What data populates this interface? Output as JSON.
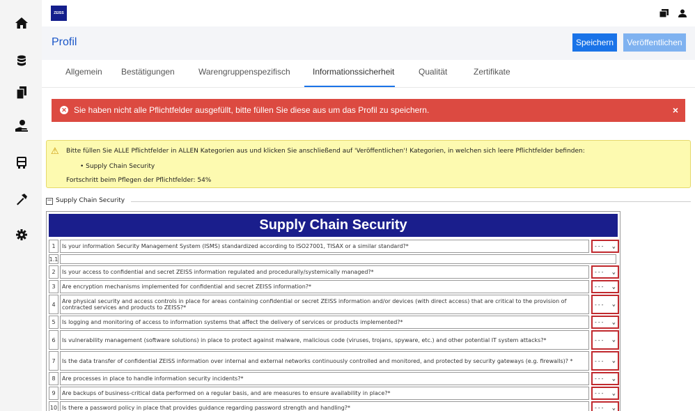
{
  "sidebar": {
    "items": [
      {
        "icon": "home-icon"
      },
      {
        "icon": "database-icon"
      },
      {
        "icon": "documents-icon"
      },
      {
        "icon": "hand-user-icon"
      },
      {
        "icon": "truck-icon"
      },
      {
        "icon": "hammer-icon"
      },
      {
        "icon": "gear-icon"
      }
    ]
  },
  "header": {
    "logo": "ZEISS",
    "title": "Profil",
    "save_label": "Speichern",
    "publish_label": "Veröffentlichen"
  },
  "tabs": [
    {
      "label": "Allgemein"
    },
    {
      "label": "Bestätigungen"
    },
    {
      "label": "Warengruppenspezifisch"
    },
    {
      "label": "Informationssicherheit"
    },
    {
      "label": "Qualität"
    },
    {
      "label": "Zertifikate"
    }
  ],
  "alert": {
    "message": "Sie haben nicht alle Pflichtfelder ausgefüllt, bitte füllen Sie diese aus um das Profil zu speichern.",
    "close": "×"
  },
  "warning": {
    "text": "Bitte füllen Sie ALLE Pflichtfelder in ALLEN Kategorien aus und klicken Sie anschließend auf 'Veröffentlichen'! Kategorien, in welchen sich leere Pflichtfelder befinden:",
    "item": "• Supply Chain Security",
    "progress": "Fortschritt beim Pflegen der Pflichtfelder: 54%"
  },
  "section": {
    "legend": "Supply Chain Security",
    "collapse": "−",
    "heading": "Supply Chain Security",
    "select_value": "---",
    "rows": [
      {
        "num": "1",
        "q": "Is your information Security Management System (ISMS) standardized according to ISO27001, TISAX or a similar standard?*"
      },
      {
        "num": "1.1",
        "q": ""
      },
      {
        "num": "2",
        "q": "Is your access to confidential and secret ZEISS information regulated and procedurally/systemically managed?*"
      },
      {
        "num": "3",
        "q": "Are encryption mechanisms implemented for confidential and secret ZEISS information?*"
      },
      {
        "num": "4",
        "q": "Are physical security and access controls in place for areas containing confidential or secret ZEISS information and/or devices (with direct access) that are critical to the provision of contracted services and products to ZEISS?*"
      },
      {
        "num": "5",
        "q": "Is logging and monitoring of access to information systems that affect the delivery of services or products implemented?*"
      },
      {
        "num": "6",
        "q": "Is vulnerability management (software solutions) in place to protect against malware, malicious code (viruses, trojans, spyware, etc.) and other potential IT system attacks?*"
      },
      {
        "num": "7",
        "q": "Is the data transfer of confidential ZEISS information over internal and external networks continuously controlled and monitored, and protected by security gateways (e.g. firewalls)? *"
      },
      {
        "num": "8",
        "q": "Are processes in place to handle information security incidents?*"
      },
      {
        "num": "9",
        "q": "Are backups of business-critical data performed on a regular basis, and are measures to ensure availability in place?*"
      },
      {
        "num": "10",
        "q": "Is there a password policy in place that provides guidance regarding password strength and handling?*"
      }
    ]
  }
}
